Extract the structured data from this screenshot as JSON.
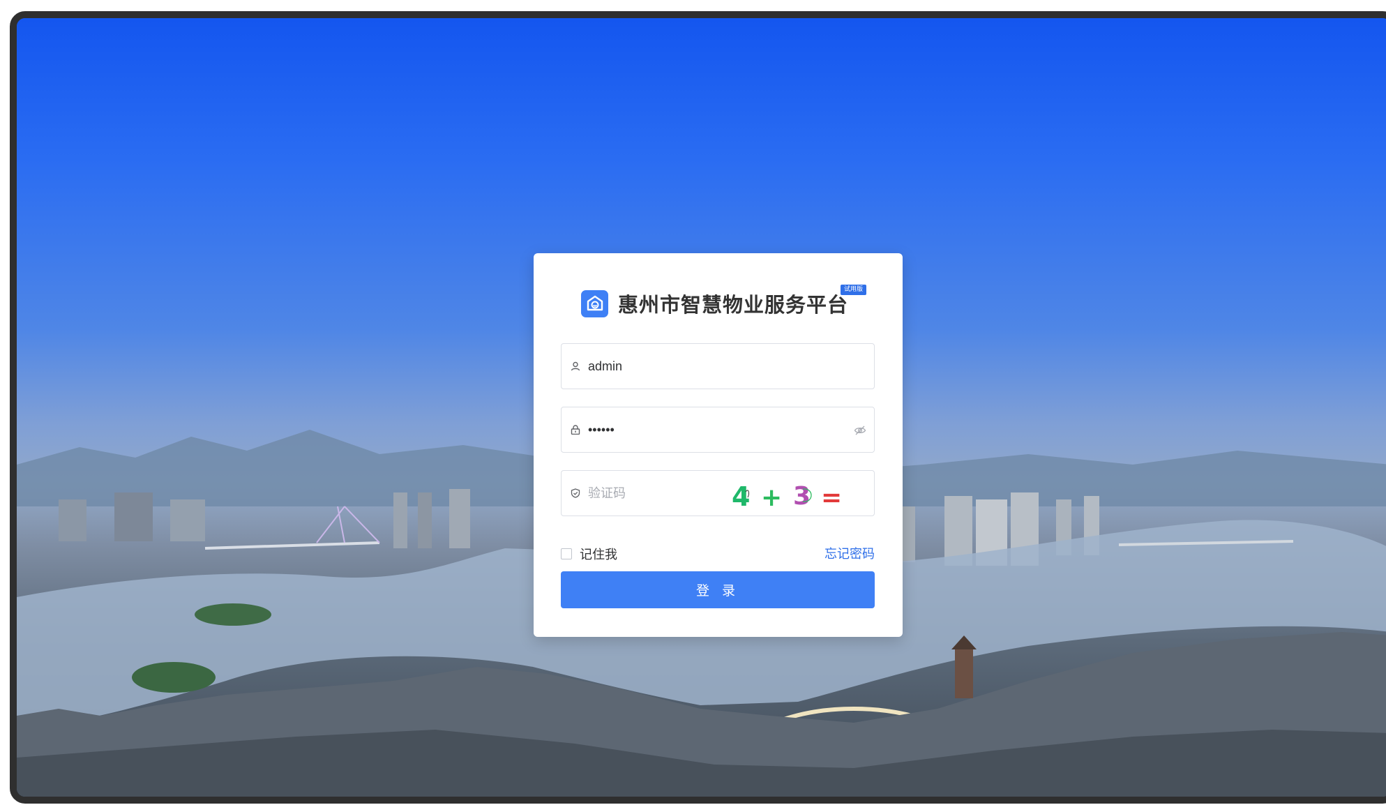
{
  "app": {
    "title": "惠州市智慧物业服务平台",
    "badge": "试用版"
  },
  "login": {
    "username": {
      "value": "admin",
      "icon": "user-icon"
    },
    "password": {
      "value": "••••••",
      "icon": "lock-icon",
      "toggle_icon": "eye-hidden-icon"
    },
    "captcha": {
      "placeholder": "验证码",
      "icon": "shield-check-icon",
      "expression": [
        "4",
        "+",
        "3",
        "="
      ]
    },
    "remember_label": "记住我",
    "forgot_label": "忘记密码",
    "submit_label": "登 录"
  },
  "colors": {
    "primary": "#3f80f5",
    "link": "#2f6fe8",
    "captcha_4": "#1fb86a",
    "captcha_plus": "#2dbb5f",
    "captcha_3": "#b14fb0",
    "captcha_eq": "#e23a3a"
  }
}
